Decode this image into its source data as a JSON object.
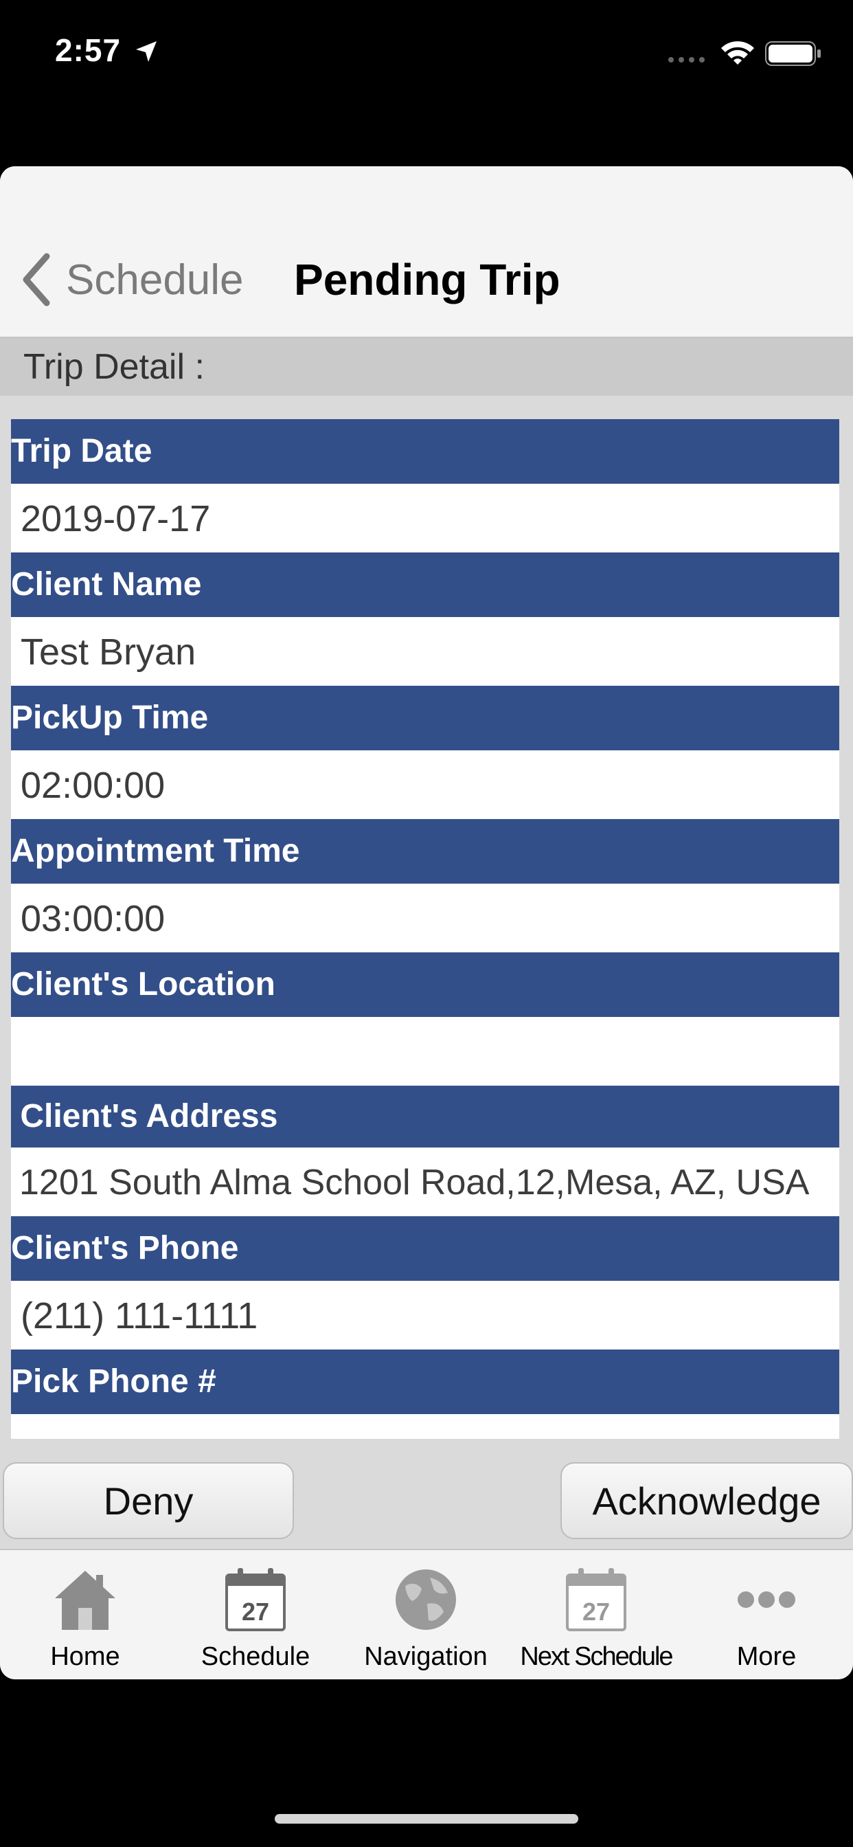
{
  "status_bar": {
    "time": "2:57"
  },
  "nav": {
    "back_label": "Schedule",
    "title": "Pending Trip"
  },
  "section": {
    "label": "Trip Detail :"
  },
  "fields": [
    {
      "label": "Trip Date",
      "value": "2019-07-17"
    },
    {
      "label": "Client Name",
      "value": "Test Bryan"
    },
    {
      "label": "PickUp Time",
      "value": "02:00:00"
    },
    {
      "label": "Appointment Time",
      "value": "03:00:00"
    },
    {
      "label": "Client's Location",
      "value": ""
    },
    {
      "label": " Client's Address",
      "value": "1201 South Alma School Road,12,Mesa, AZ, USA"
    },
    {
      "label": "Client's Phone",
      "value": "(211) 111-1111"
    },
    {
      "label": "Pick Phone #",
      "value": ""
    }
  ],
  "actions": {
    "deny_label": "Deny",
    "acknowledge_label": "Acknowledge"
  },
  "tab_bar": {
    "tabs": [
      {
        "label": "Home",
        "icon": "house-icon"
      },
      {
        "label": "Schedule",
        "icon": "calendar-icon",
        "day": "27"
      },
      {
        "label": "Navigation",
        "icon": "globe-icon"
      },
      {
        "label": "Next Schedule",
        "icon": "calendar-icon",
        "day": "27"
      },
      {
        "label": "More",
        "icon": "more-dots-icon"
      }
    ]
  },
  "colors": {
    "label_bg": "#334f89",
    "sheet_bg": "#dadada",
    "nav_bg": "#f4f4f4"
  }
}
